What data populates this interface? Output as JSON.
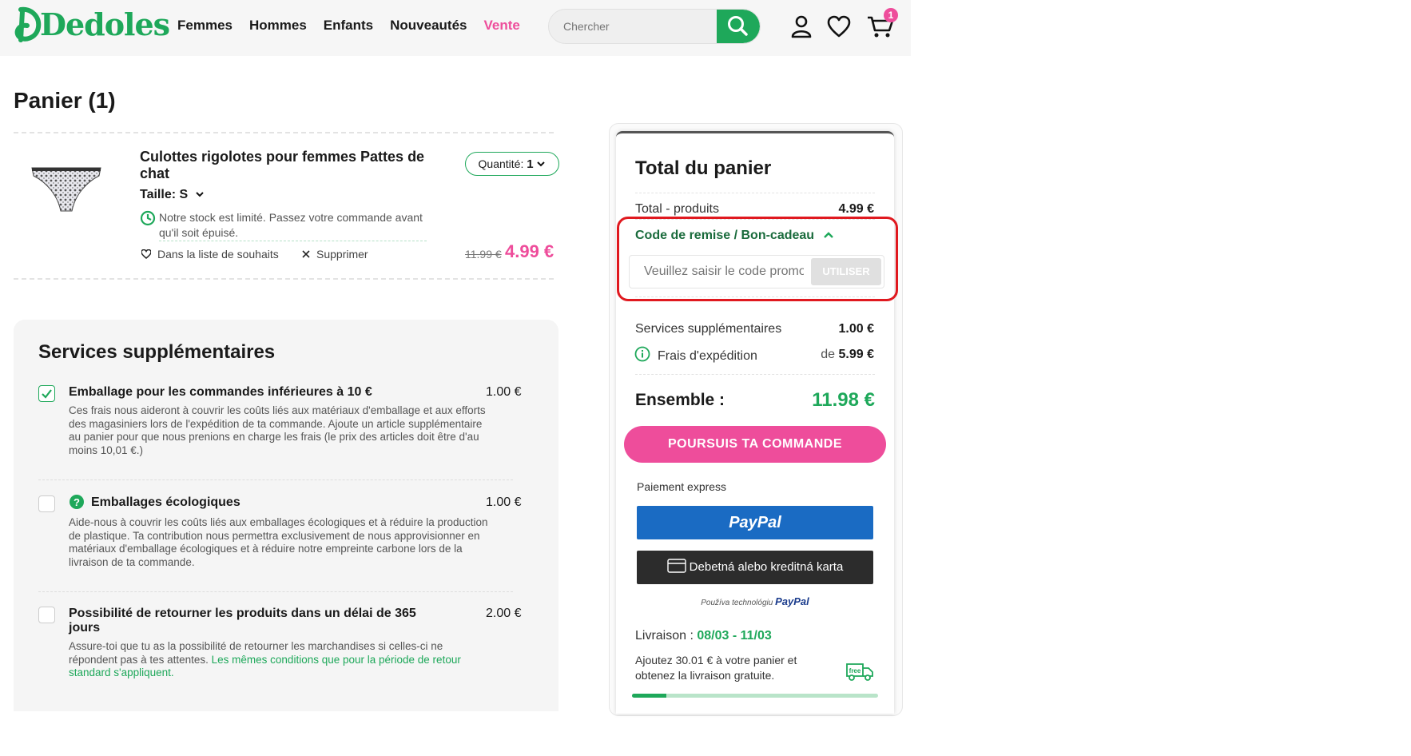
{
  "header": {
    "logo": "Dedoles",
    "nav": [
      "Femmes",
      "Hommes",
      "Enfants",
      "Nouveautés",
      "Vente"
    ],
    "search_placeholder": "Chercher",
    "cart_count": "1",
    "icons": [
      "search-icon",
      "user-icon",
      "heart-icon",
      "cart-icon"
    ]
  },
  "cart": {
    "title": "Panier (1)",
    "item": {
      "name": "Culottes rigolotes pour femmes Pattes de chat",
      "size": "Taille: S",
      "quantity_label": "Quantité:",
      "quantity": "1",
      "stock_note": "Notre stock est limité. Passez votre commande avant qu'il soit épuisé.",
      "wishlist": "Dans la liste de souhaits",
      "remove": "Supprimer",
      "old_price": "11.99 €",
      "price": "4.99 €"
    }
  },
  "services": {
    "title": "Services supplémentaires",
    "items": [
      {
        "name": "Emballage pour les commandes inférieures à 10 €",
        "price": "1.00 €",
        "checked": true,
        "desc": "Ces frais nous aideront à couvrir les coûts liés aux matériaux d'emballage et aux efforts des magasiniers lors de l'expédition de ta commande. Ajoute un article supplémentaire au panier pour que nous prenions en charge les frais (le prix des articles doit être d'au moins 10,01 €.)"
      },
      {
        "name": "Emballages écologiques",
        "price": "1.00 €",
        "checked": false,
        "desc": "Aide-nous à couvrir les coûts liés aux emballages écologiques et à réduire la production de plastique. Ta contribution nous permettra exclusivement de nous approvisionner en matériaux d'emballage écologiques et à réduire notre empreinte carbone lors de la livraison de ta commande."
      },
      {
        "name": "Possibilité de retourner les produits dans un délai de 365 jours",
        "price": "2.00 €",
        "checked": false,
        "desc": "Assure-toi que tu as la possibilité de retourner les marchandises si celles-ci ne répondent pas à tes attentes.",
        "desc_link": "Les mêmes conditions que pour la période de retour standard s'appliquent."
      }
    ]
  },
  "summary": {
    "title": "Total du panier",
    "products_label": "Total - produits",
    "products_value": "4.99 €",
    "promo_label": "Code de remise / Bon-cadeau",
    "promo_placeholder": "Veuillez saisir le code promo",
    "promo_button": "UTILISER",
    "services_label": "Services supplémentaires",
    "services_value": "1.00 €",
    "shipping_label": "Frais d'expédition",
    "shipping_prefix": "de",
    "shipping_value": "5.99 €",
    "total_label": "Ensemble :",
    "total_value": "11.98 €",
    "checkout_button": "POURSUIS TA COMMANDE",
    "express_label": "Paiement express",
    "paypal_label": "PayPal",
    "card_label": "Debetná alebo kreditná karta",
    "powered_text": "Používa technológiu",
    "powered_brand": "PayPal",
    "delivery_label": "Livraison :",
    "delivery_dates": "08/03 - 11/03",
    "free_shipping_text": "Ajoutez 30.01 € à votre panier et obtenez la livraison gratuite.",
    "free_icon_label": "free",
    "free_shipping_progress": 0.14
  },
  "colors": {
    "brand_green": "#1ea85a",
    "sale_pink": "#ee4d9b",
    "paypal_blue": "#1a6bc3",
    "highlight_red": "#e0191f"
  }
}
